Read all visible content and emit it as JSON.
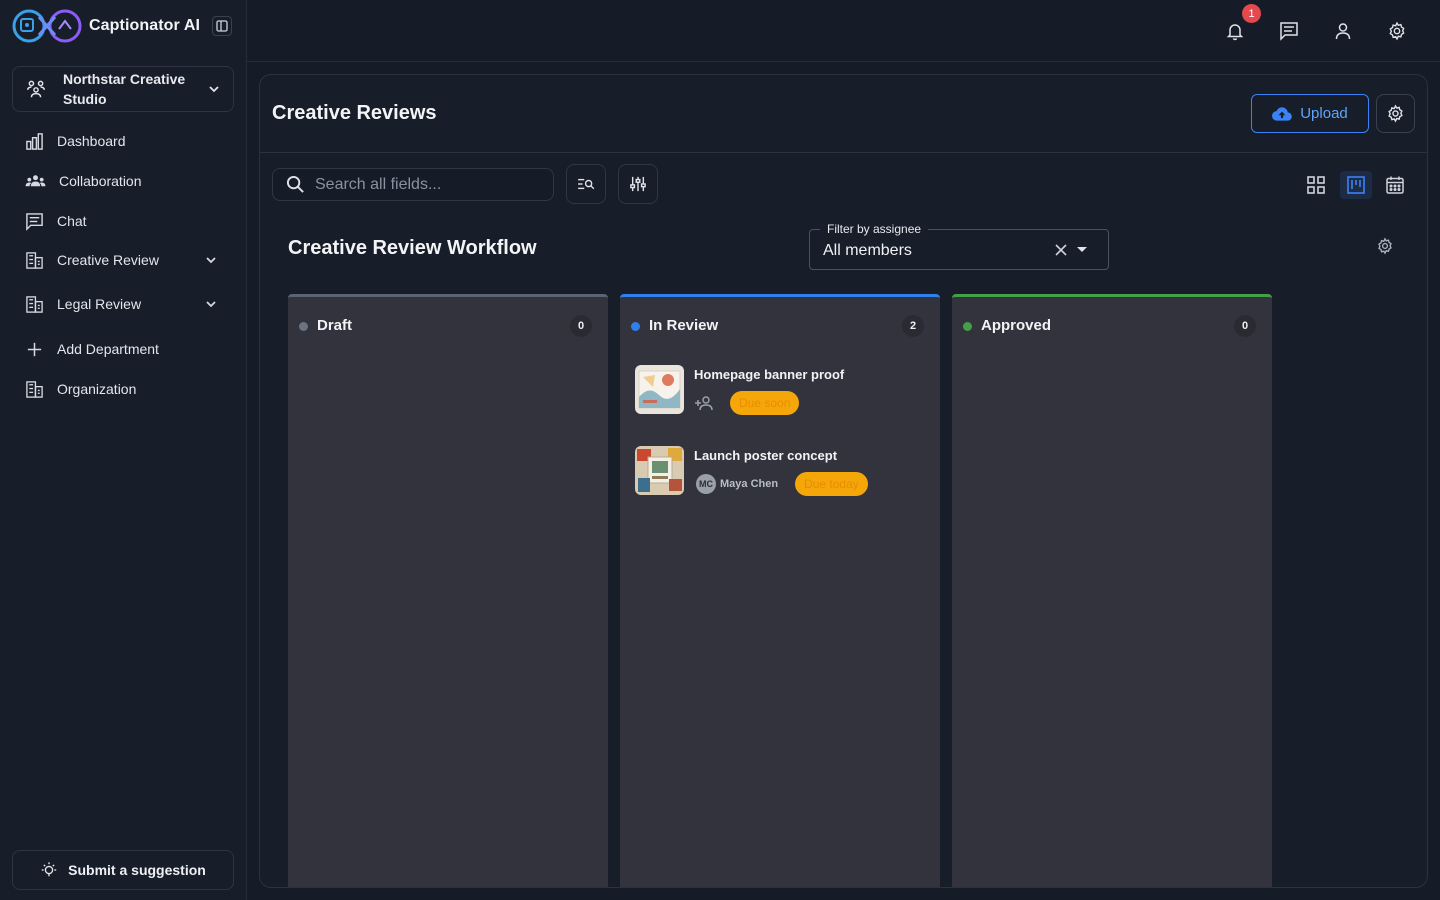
{
  "app": {
    "name": "Captionator AI",
    "org_name": "Northstar Creative Studio"
  },
  "sidebar": {
    "items": [
      {
        "label": "Dashboard",
        "icon": "bar-chart-icon"
      },
      {
        "label": "Collaboration",
        "icon": "group-icon"
      },
      {
        "label": "Chat",
        "icon": "chat-icon"
      },
      {
        "label": "Creative Review",
        "icon": "building-icon",
        "expandable": true
      },
      {
        "label": "Legal Review",
        "icon": "building-icon",
        "expandable": true
      },
      {
        "label": "Add Department",
        "icon": "plus-icon"
      },
      {
        "label": "Organization",
        "icon": "building-icon"
      }
    ],
    "suggestion_label": "Submit a suggestion"
  },
  "topbar": {
    "notification_count": "1",
    "icons": [
      "bell-icon",
      "chat-icon",
      "user-icon",
      "gear-icon"
    ]
  },
  "page": {
    "title": "Creative Reviews",
    "upload_label": "Upload",
    "search_placeholder": "Search all fields..."
  },
  "board": {
    "title": "Creative Review Workflow",
    "filter": {
      "legend": "Filter by assignee",
      "value": "All members"
    },
    "columns": [
      {
        "title": "Draft",
        "count": "0",
        "color": "#6b7280",
        "cards": []
      },
      {
        "title": "In Review",
        "count": "2",
        "color": "#2f80ed",
        "cards": [
          {
            "title": "Homepage banner proof",
            "assignee": null,
            "due": "Due soon"
          },
          {
            "title": "Launch poster concept",
            "assignee_initials": "MC",
            "assignee": "Maya Chen",
            "due": "Due today"
          }
        ]
      },
      {
        "title": "Approved",
        "count": "0",
        "color": "#43a047",
        "cards": []
      }
    ]
  },
  "colors": {
    "accent": "#3b82f6",
    "due_pill": "#f5a70a",
    "badge": "#e5484d"
  }
}
